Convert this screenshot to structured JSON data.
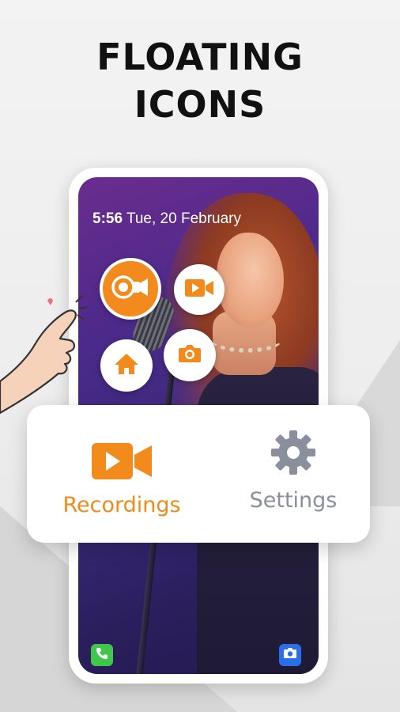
{
  "headline": {
    "line1": "FLOATING",
    "line2": "ICONS"
  },
  "status_bar": {
    "time": "5:56",
    "date": "Tue, 20 February"
  },
  "floating_menu": {
    "main": "screen-recorder-icon",
    "video": "video-camera-icon",
    "home": "home-icon",
    "camera": "camera-icon"
  },
  "dock": {
    "left": "phone-icon",
    "right": "camera-icon"
  },
  "card": {
    "recordings_label": "Recordings",
    "settings_label": "Settings"
  },
  "colors": {
    "accent": "#f28a1c",
    "muted": "#8a8f9e",
    "phone_green": "#3fc74a",
    "camera_blue": "#2b6fe8"
  }
}
